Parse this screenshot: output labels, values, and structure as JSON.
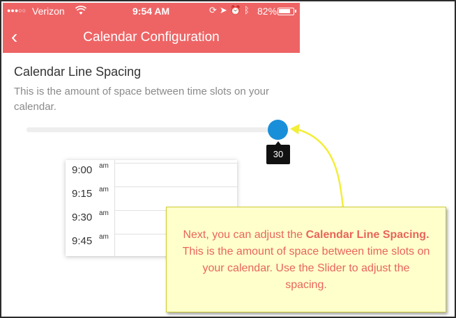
{
  "status_bar": {
    "signal": "●●●○○",
    "carrier": "Verizon",
    "time": "9:54 AM",
    "battery": "82%"
  },
  "nav": {
    "back_glyph": "‹",
    "title": "Calendar Configuration"
  },
  "section": {
    "title": "Calendar Line Spacing",
    "description": "This is the amount of space between time slots on your calendar."
  },
  "slider": {
    "value_label": "30"
  },
  "calendar": {
    "rows": [
      {
        "time": "9:00",
        "ampm": "am"
      },
      {
        "time": "9:15",
        "ampm": "am"
      },
      {
        "time": "9:30",
        "ampm": "am"
      },
      {
        "time": "9:45",
        "ampm": "am"
      }
    ]
  },
  "callout": {
    "part1": "Next, you can adjust the ",
    "bold": "Calendar Line Spacing.",
    "part2": " This is the amount of space between time slots on your calendar. Use the Slider to adjust the spacing."
  },
  "colors": {
    "header": "#ee6465",
    "slider_thumb": "#1a8fd9",
    "callout_bg": "#ffffcc",
    "callout_text": "#e8655a",
    "arrow": "#f3ee3a"
  }
}
